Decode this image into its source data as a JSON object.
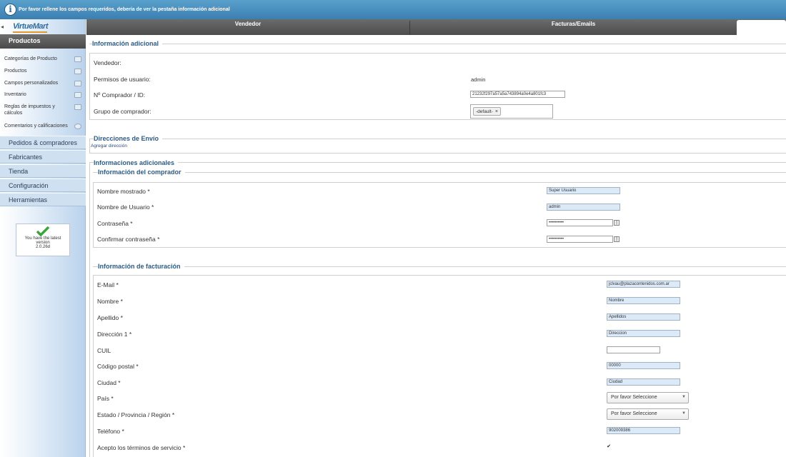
{
  "notice": {
    "icon": "info-icon",
    "message": "Por favor rellene los campos requeridos, debería de ver la pestaña información adicional"
  },
  "sidebar": {
    "logo": "VirtueMart",
    "section": "Productos",
    "subitems": [
      {
        "label": "Categorías de Producto",
        "icon": "category-icon"
      },
      {
        "label": "Productos",
        "icon": "products-icon"
      },
      {
        "label": "Campos personalizados",
        "icon": "custom-fields-icon"
      },
      {
        "label": "Inventario",
        "icon": "inventory-icon"
      },
      {
        "label": "Reglas de impuestos y cálculos",
        "icon": "tax-icon"
      },
      {
        "label": "Comentarios y calificaciones",
        "icon": "reviews-icon"
      }
    ],
    "menu": [
      "Pedidos & compradores",
      "Fabricantes",
      "Tienda",
      "Configuración",
      "Herramientas"
    ],
    "version": {
      "line1": "You have the latest",
      "line2": "version",
      "line3": "2.0.26d"
    }
  },
  "tabs": [
    "Vendedor",
    "Facturas/Emails",
    ""
  ],
  "info_adicional": {
    "title": "Información adicional",
    "vendedor_label": "Vendedor:",
    "permisos_label": "Permisos de usuario:",
    "permisos_value": "admin",
    "comprador_label": "Nº Comprador / ID:",
    "comprador_value": "21232f297a57a5a743894a0e4a801fc3",
    "grupo_label": "Grupo de comprador:",
    "grupo_tag": "-default-"
  },
  "direcciones": {
    "title": "Direcciones de Envío",
    "add_link": "Agregar dirección"
  },
  "informaciones": {
    "title": "Informaciones adicionales"
  },
  "comprador": {
    "title": "Información del comprador",
    "fields": [
      {
        "label": "Nombre mostrado *",
        "value": "Super Usuario"
      },
      {
        "label": "Nombre de Usuario *",
        "value": "admin"
      },
      {
        "label": "Contraseña *",
        "value": "••••••••••"
      },
      {
        "label": "Confirmar contraseña *",
        "value": "••••••••••"
      }
    ]
  },
  "facturacion": {
    "title": "Información de facturación",
    "fields": [
      {
        "label": "E-Mail *",
        "value": "jclvau@plazacontenidos.com.ar"
      },
      {
        "label": "Nombre *",
        "value": "Nombre"
      },
      {
        "label": "Apellido *",
        "value": "Apellidos"
      },
      {
        "label": "Dirección 1 *",
        "value": "Direccion"
      },
      {
        "label": "CUIL",
        "value": ""
      },
      {
        "label": "Código postal *",
        "value": "00000"
      },
      {
        "label": "Ciudad *",
        "value": "Ciudad"
      },
      {
        "label": "País *",
        "value": "Por favor Seleccione"
      },
      {
        "label": "Estado / Provincia / Región *",
        "value": "Por favor Seleccione"
      },
      {
        "label": "Teléfono *",
        "value": "902009386"
      },
      {
        "label": "Acepto los términos de servicio *",
        "value": "✔"
      }
    ]
  }
}
